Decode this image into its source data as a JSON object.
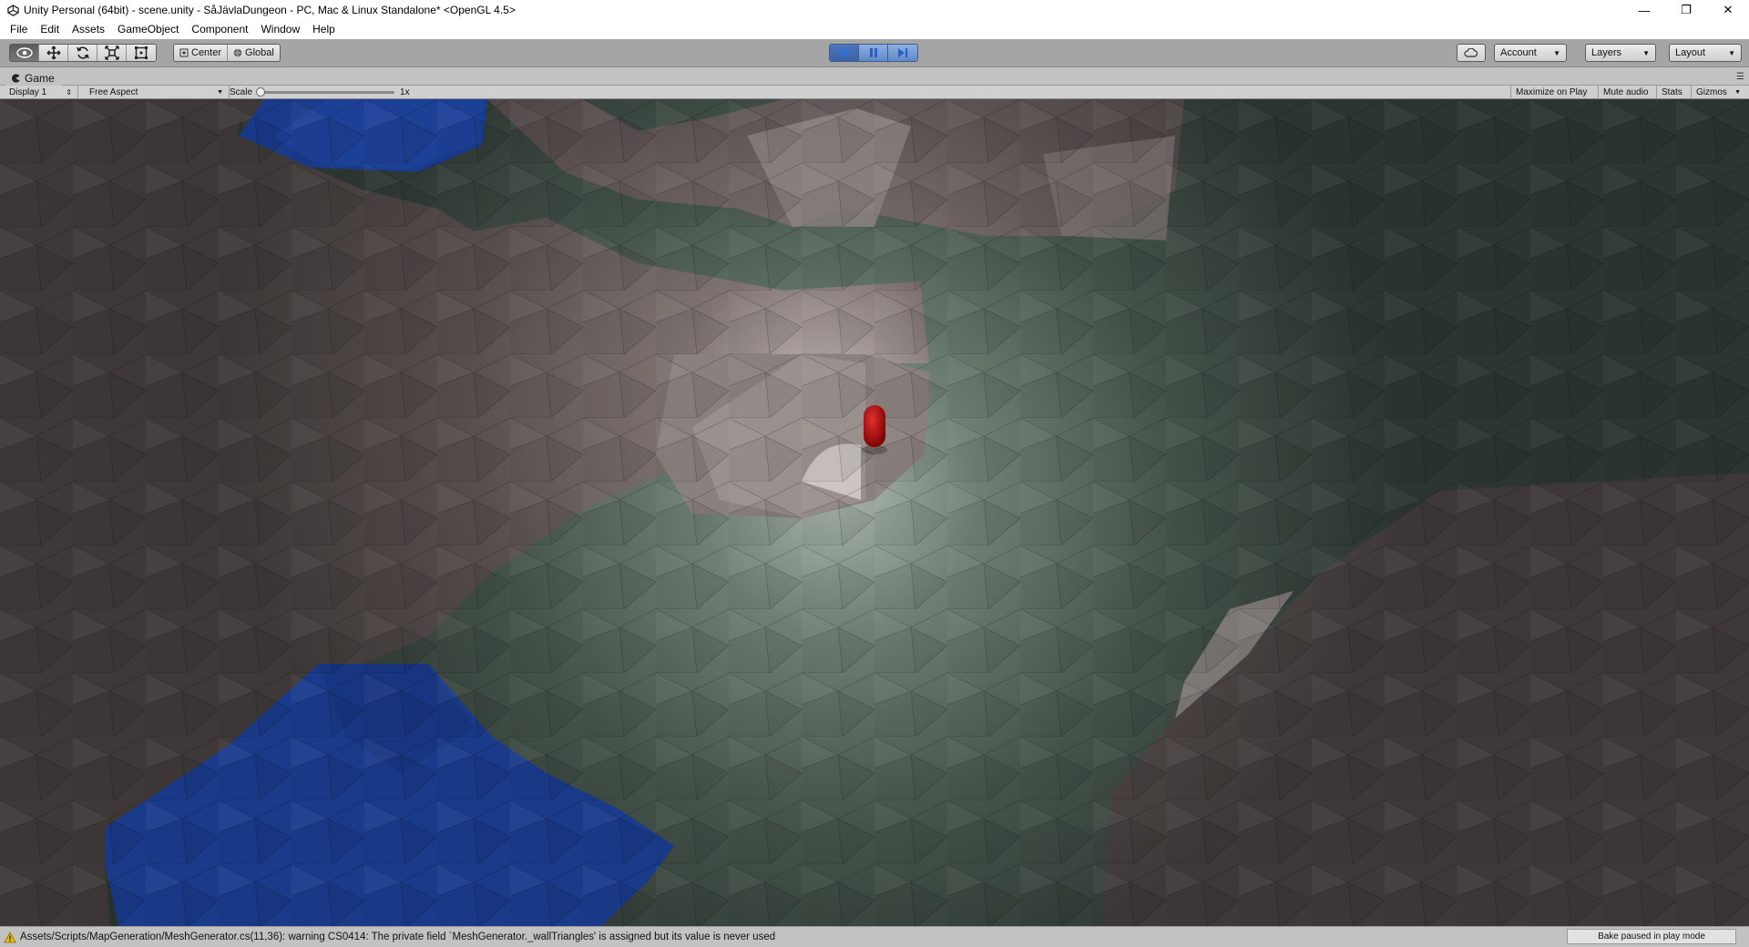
{
  "window": {
    "title": "Unity Personal (64bit) - scene.unity - SåJävlaDungeon - PC, Mac & Linux Standalone* <OpenGL 4.5>",
    "minimize_icon": "minimize-icon",
    "maximize_icon": "restore-icon",
    "close_icon": "close-icon"
  },
  "menu": [
    "File",
    "Edit",
    "Assets",
    "GameObject",
    "Component",
    "Window",
    "Help"
  ],
  "toolbar": {
    "tools": [
      "view-hand-icon",
      "move-icon",
      "rotate-icon",
      "scale-icon",
      "rect-tool-icon"
    ],
    "pivot_mode": "Center",
    "pivot_rotation": "Global",
    "play_state": "playing",
    "account_label": "Account",
    "layers_label": "Layers",
    "layout_label": "Layout"
  },
  "game_tab": {
    "label": "Game",
    "display": "Display 1",
    "aspect": "Free Aspect",
    "scale_label": "Scale",
    "scale_value": "1x",
    "maximize_on_play": "Maximize on Play",
    "mute_audio": "Mute audio",
    "stats": "Stats",
    "gizmos": "Gizmos"
  },
  "status": {
    "message": "Assets/Scripts/MapGeneration/MeshGenerator.cs(11,36): warning CS0414: The private field `MeshGenerator._wallTriangles' is assigned but its value is never used",
    "bake": "Bake paused in play mode"
  },
  "colors": {
    "rock": "#6e6664",
    "floor": "#55645a",
    "water": "#1a3a8a",
    "player": "#b00000",
    "play_accent": "#4d76bb"
  }
}
